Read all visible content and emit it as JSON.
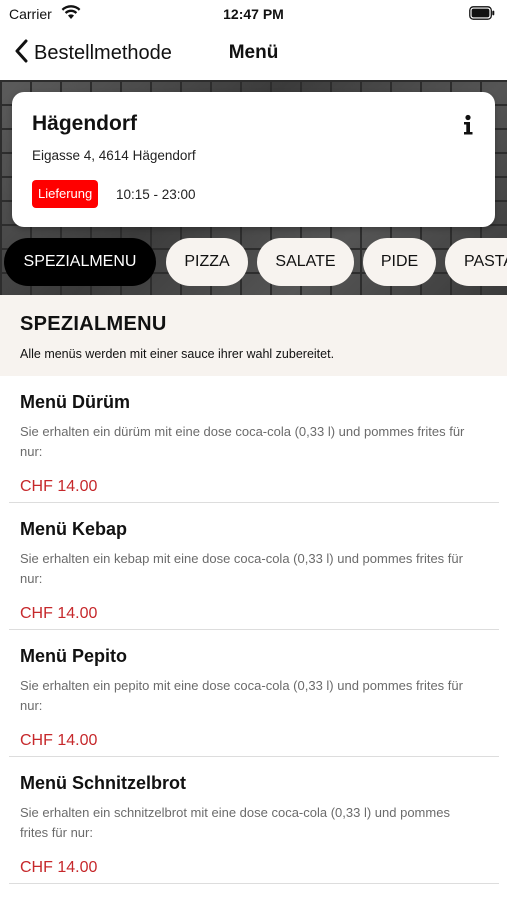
{
  "status_bar": {
    "carrier": "Carrier",
    "time": "12:47 PM",
    "wifi_icon": "wifi-icon",
    "battery_icon": "battery-icon"
  },
  "nav": {
    "back_label": "Bestellmethode",
    "back_icon": "chevron-left-icon",
    "title": "Menü"
  },
  "store": {
    "name": "Hägendorf",
    "address": "Eigasse 4, 4614 Hägendorf",
    "delivery_label": "Lieferung",
    "hours": "10:15 - 23:00",
    "info_icon": "info-icon",
    "badge_color": "#ff0000"
  },
  "categories": [
    {
      "label": "SPEZIALMENU",
      "active": true
    },
    {
      "label": "PIZZA",
      "active": false
    },
    {
      "label": "SALATE",
      "active": false
    },
    {
      "label": "PIDE",
      "active": false
    },
    {
      "label": "PASTA",
      "active": false
    }
  ],
  "section": {
    "title": "SPEZIALMENU",
    "description": "Alle menüs werden mit einer sauce ihrer wahl zubereitet."
  },
  "menu_items": [
    {
      "name": "Menü Dürüm",
      "description": "Sie erhalten ein dürüm mit eine dose coca-cola (0,33 l) und pommes frites für nur:",
      "price": "CHF 14.00"
    },
    {
      "name": "Menü Kebap",
      "description": "Sie erhalten ein kebap mit eine dose coca-cola (0,33 l) und pommes frites für nur:",
      "price": "CHF 14.00"
    },
    {
      "name": "Menü Pepito",
      "description": "Sie erhalten ein pepito mit eine dose coca-cola (0,33 l) und pommes frites für nur:",
      "price": "CHF 14.00"
    },
    {
      "name": "Menü Schnitzelbrot",
      "description": "Sie erhalten ein schnitzelbrot mit eine dose coca-cola (0,33 l) und pommes frites für nur:",
      "price": "CHF 14.00"
    }
  ],
  "colors": {
    "price": "#c6282b",
    "accent_bg": "#f7f3ef",
    "active_pill": "#000000"
  }
}
